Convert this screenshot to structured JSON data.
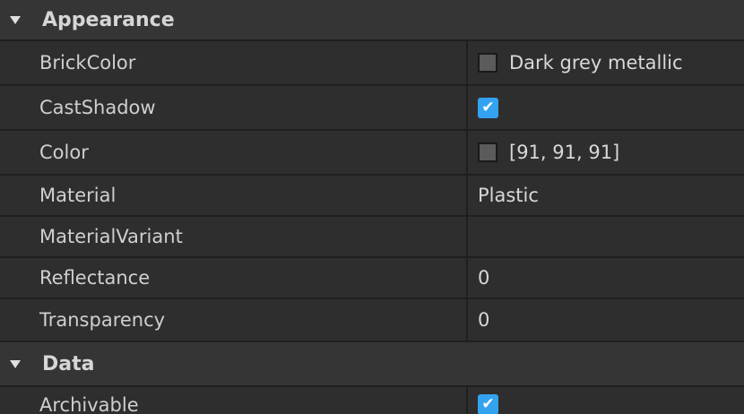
{
  "sections": [
    {
      "title": "Appearance",
      "properties": [
        {
          "name": "BrickColor",
          "value": "Dark grey metallic",
          "swatch_color": "#5b5b5b"
        },
        {
          "name": "CastShadow",
          "value": "",
          "checked": true
        },
        {
          "name": "Color",
          "value": "[91, 91, 91]",
          "swatch_color": "#5b5b5b"
        },
        {
          "name": "Material",
          "value": "Plastic"
        },
        {
          "name": "MaterialVariant",
          "value": ""
        },
        {
          "name": "Reflectance",
          "value": "0"
        },
        {
          "name": "Transparency",
          "value": "0"
        }
      ]
    },
    {
      "title": "Data",
      "properties": [
        {
          "name": "Archivable",
          "value": "",
          "checked": true
        }
      ]
    }
  ],
  "icons": {
    "collapse": "caret-down-icon",
    "check": "checkmark-icon"
  },
  "colors": {
    "accent": "#33a3f0",
    "background": "#2e2e2e",
    "header": "#353535"
  }
}
